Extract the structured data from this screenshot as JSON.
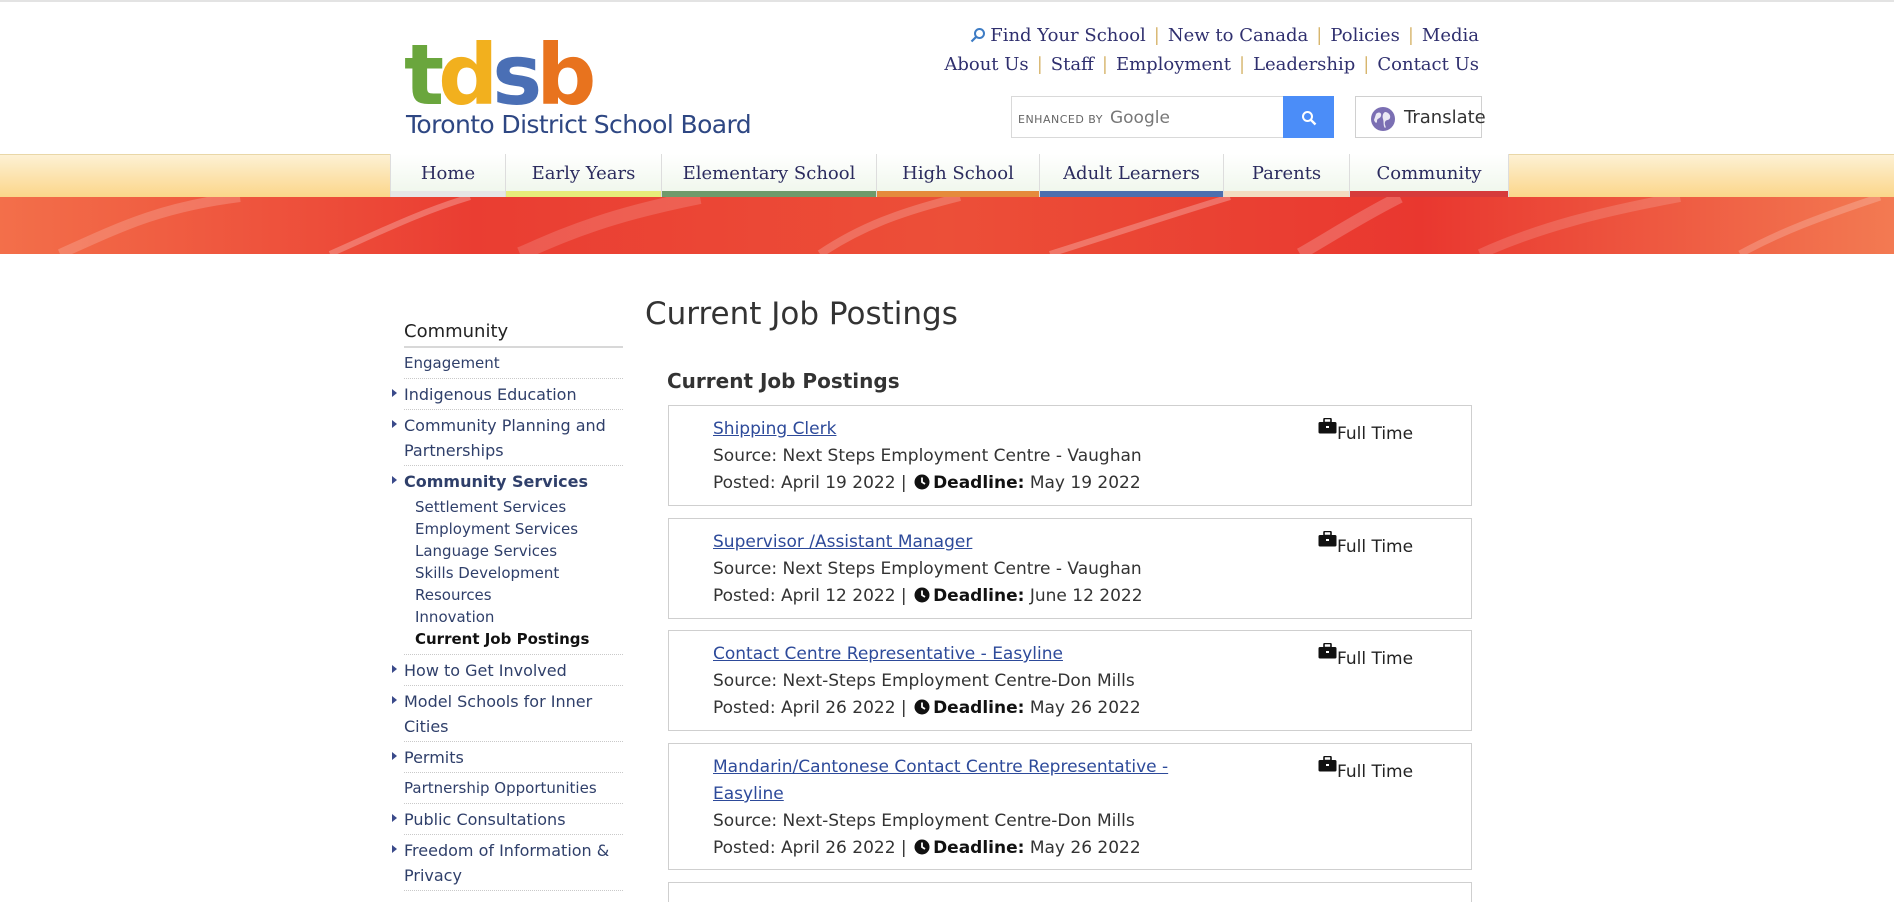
{
  "logo": {
    "letters": [
      "t",
      "d",
      "s",
      "b"
    ],
    "letter_colors": [
      "#6aa63d",
      "#f2b01e",
      "#4a6fb5",
      "#e8731e"
    ],
    "name": "Toronto District School Board"
  },
  "utility_nav": {
    "row1": [
      "Find Your School",
      "New to Canada",
      "Policies",
      "Media"
    ],
    "row2": [
      "About Us",
      "Staff",
      "Employment",
      "Leadership",
      "Contact Us"
    ]
  },
  "search": {
    "brand_prefix": "ENHANCED BY",
    "brand_name": "Google",
    "value": ""
  },
  "translate": {
    "label": "Translate"
  },
  "main_nav": [
    {
      "label": "Home",
      "color": "#e6e6e6"
    },
    {
      "label": "Early Years",
      "color": "#e7ec7a"
    },
    {
      "label": "Elementary School",
      "color": "#6f9a6b"
    },
    {
      "label": "High School",
      "color": "#e58a3c"
    },
    {
      "label": "Adult Learners",
      "color": "#4d6fae"
    },
    {
      "label": "Parents",
      "color": "#f3dcc0"
    },
    {
      "label": "Community",
      "color": "#d63b3b"
    }
  ],
  "sidebar": {
    "title": "Community",
    "items_before": [
      {
        "label": "Engagement",
        "arrow": false,
        "small": true
      },
      {
        "label": "Indigenous Education",
        "arrow": true,
        "small": false
      },
      {
        "label": "Community Planning and Partnerships",
        "arrow": true,
        "small": false
      }
    ],
    "active": {
      "label": "Community Services",
      "arrow": true
    },
    "sub_items": [
      "Settlement Services",
      "Employment Services",
      "Language Services",
      "Skills Development",
      "Resources",
      "Innovation",
      "Current Job Postings"
    ],
    "current_sub": "Current Job Postings",
    "items_after": [
      {
        "label": "How to Get Involved",
        "arrow": true,
        "small": false
      },
      {
        "label": "Model Schools for Inner Cities",
        "arrow": true,
        "small": false
      },
      {
        "label": "Permits",
        "arrow": true,
        "small": false
      },
      {
        "label": "Partnership Opportunities",
        "arrow": false,
        "small": true
      },
      {
        "label": "Public Consultations",
        "arrow": true,
        "small": false
      },
      {
        "label": "Freedom of Information & Privacy",
        "arrow": true,
        "small": false
      }
    ]
  },
  "main": {
    "page_title": "Current Job Postings",
    "section_title": "Current Job Postings",
    "posted_label": "Posted:",
    "deadline_label": "Deadline:",
    "jobs": [
      {
        "title": "Shipping Clerk",
        "source": "Source: Next Steps Employment Centre - Vaughan",
        "posted": "April 19 2022",
        "deadline": "May 19 2022",
        "type": "Full Time"
      },
      {
        "title": "Supervisor /Assistant Manager",
        "source": "Source: Next Steps Employment Centre - Vaughan",
        "posted": "April 12 2022",
        "deadline": "June 12 2022",
        "type": "Full Time"
      },
      {
        "title": "Contact Centre Representative - Easyline",
        "source": "Source: Next-Steps Employment Centre-Don Mills",
        "posted": "April 26 2022",
        "deadline": "May 26 2022",
        "type": "Full Time"
      },
      {
        "title": "Mandarin/Cantonese Contact Centre Representative - Easyline",
        "source": "Source: Next-Steps Employment Centre-Don Mills",
        "posted": "April 26 2022",
        "deadline": "May 26 2022",
        "type": "Full Time"
      }
    ]
  }
}
